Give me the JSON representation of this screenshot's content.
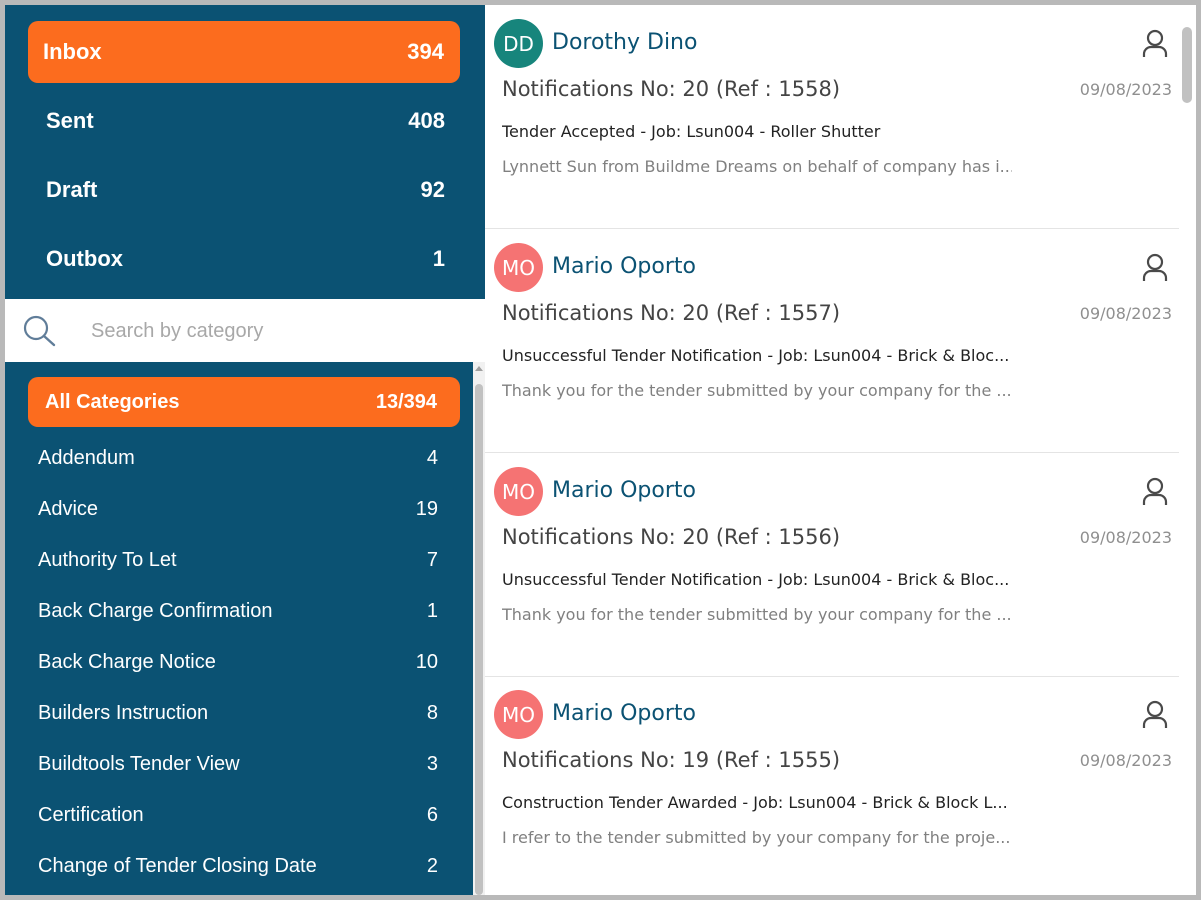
{
  "folders": [
    {
      "label": "Inbox",
      "count": "394"
    },
    {
      "label": "Sent",
      "count": "408"
    },
    {
      "label": "Draft",
      "count": "92"
    },
    {
      "label": "Outbox",
      "count": "1"
    }
  ],
  "search": {
    "placeholder": "Search by category"
  },
  "categories": {
    "all": {
      "label": "All Categories",
      "count": "13/394"
    },
    "items": [
      {
        "label": "Addendum",
        "count": "4"
      },
      {
        "label": "Advice",
        "count": "19"
      },
      {
        "label": "Authority To Let",
        "count": "7"
      },
      {
        "label": "Back Charge Confirmation",
        "count": "1"
      },
      {
        "label": "Back Charge Notice",
        "count": "10"
      },
      {
        "label": "Builders Instruction",
        "count": "8"
      },
      {
        "label": "Buildtools Tender View",
        "count": "3"
      },
      {
        "label": "Certification",
        "count": "6"
      },
      {
        "label": "Change of Tender Closing Date",
        "count": "2"
      }
    ]
  },
  "messages": [
    {
      "initials": "DD",
      "avatar_color": "#17857c",
      "sender": "Dorothy Dino",
      "subject": "Notifications No: 20 (Ref : 1558)",
      "date": "09/08/2023",
      "title": "Tender Accepted - Job: Lsun004 - Roller Shutter",
      "preview": "Lynnett Sun from Buildme Dreams on behalf of company has i..."
    },
    {
      "initials": "MO",
      "avatar_color": "#f57373",
      "sender": "Mario Oporto",
      "subject": "Notifications No: 20 (Ref : 1557)",
      "date": "09/08/2023",
      "title": "Unsuccessful Tender Notification - Job: Lsun004 - Brick & Bloc...",
      "preview": "Thank you for the tender submitted by your company for the ..."
    },
    {
      "initials": "MO",
      "avatar_color": "#f57373",
      "sender": "Mario Oporto",
      "subject": "Notifications No: 20 (Ref : 1556)",
      "date": "09/08/2023",
      "title": "Unsuccessful Tender Notification - Job: Lsun004 - Brick & Bloc...",
      "preview": "Thank you for the tender submitted by your company for the ..."
    },
    {
      "initials": "MO",
      "avatar_color": "#f57373",
      "sender": "Mario Oporto",
      "subject": "Notifications No: 19 (Ref : 1555)",
      "date": "09/08/2023",
      "title": "Construction Tender Awarded - Job: Lsun004 - Brick & Block L...",
      "preview": "I refer to the tender submitted by your company for the proje..."
    }
  ],
  "colors": {
    "accent": "#fc6c1e",
    "panel": "#0b5273"
  },
  "icons": {
    "search": "search-icon",
    "person": "person-icon"
  }
}
